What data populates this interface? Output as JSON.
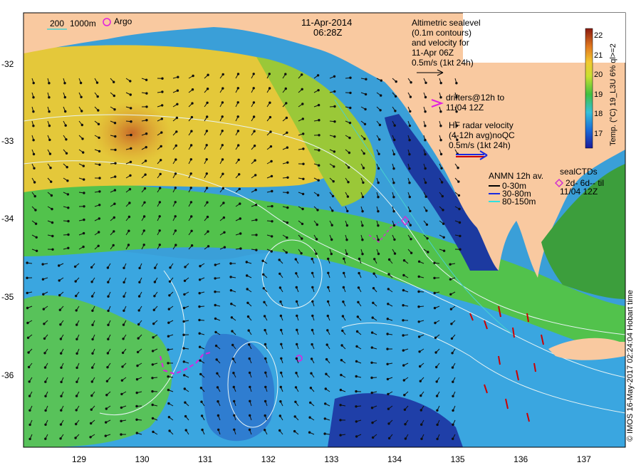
{
  "title": {
    "date": "11-Apr-2014",
    "time": "06:28Z"
  },
  "legend": {
    "bathy": {
      "a": "200",
      "b": "1000m"
    },
    "argo": "Argo",
    "altimetry": [
      "Altimetric sealevel",
      "(0.1m contours)",
      "and velocity for",
      "11-Apr 06Z",
      "0.5m/s (1kt 24h)"
    ],
    "drifters": [
      "drifters@12h to",
      "11/04 12Z"
    ],
    "hf_radar": [
      "HF radar velocity",
      "(4-12h avg)noQC",
      "0.5m/s (1kt 24h)"
    ],
    "anmn": [
      "ANMN 12h av.",
      "0-30m",
      "30-80m",
      "80-150m"
    ],
    "sealctd": [
      "sealCTDs",
      "2d- 6d-- til",
      "11/04 12Z"
    ]
  },
  "colorbar": {
    "title": "Temp. (°C) 19_L3U 6% ql>=2",
    "min": 16.3,
    "max": 22.4,
    "ticks": [
      17,
      18,
      19,
      20,
      21,
      22
    ]
  },
  "axes": {
    "lat_ticks": [
      "-32",
      "-33",
      "-34",
      "-35",
      "-36"
    ],
    "lon_ticks": [
      "129",
      "130",
      "131",
      "132",
      "133",
      "134",
      "135",
      "136",
      "137"
    ]
  },
  "credit": "© IMOS 16-May-2017 02:24:04 Hobart time",
  "colors": {
    "land": "#f9c9a0",
    "argo": "#e020e0",
    "seal": "#d030d0",
    "radar": "#cc0000",
    "contour": "#e8f4f4"
  }
}
